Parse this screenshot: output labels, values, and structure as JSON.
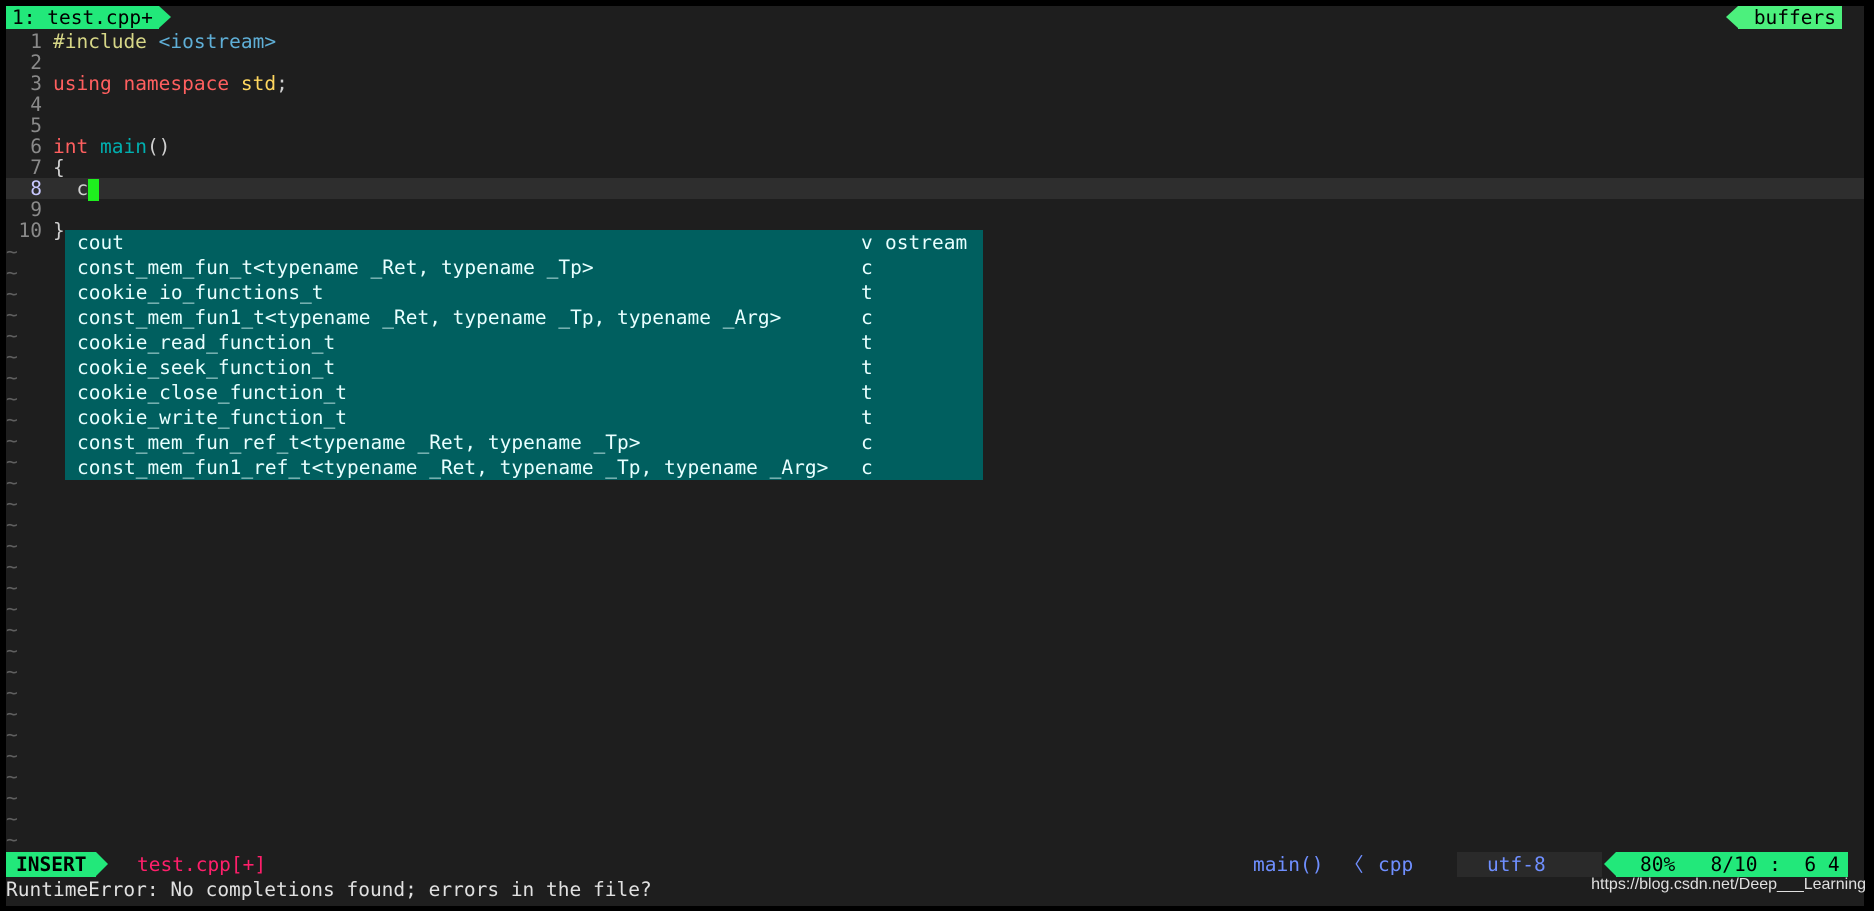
{
  "tabline": {
    "active_tab": "1: test.cpp+",
    "right_label": "buffers"
  },
  "code_lines": [
    {
      "num": "1",
      "tokens": [
        {
          "t": "#include ",
          "c": "pre"
        },
        {
          "t": "<iostream>",
          "c": "inc"
        }
      ]
    },
    {
      "num": "2",
      "tokens": []
    },
    {
      "num": "3",
      "tokens": [
        {
          "t": "using ",
          "c": "kw-red"
        },
        {
          "t": "namespace ",
          "c": "kw-red"
        },
        {
          "t": "std",
          "c": "std"
        },
        {
          "t": ";",
          "c": ""
        }
      ]
    },
    {
      "num": "4",
      "tokens": []
    },
    {
      "num": "5",
      "tokens": []
    },
    {
      "num": "6",
      "tokens": [
        {
          "t": "int ",
          "c": "kw-red"
        },
        {
          "t": "main",
          "c": "fn"
        },
        {
          "t": "()",
          "c": ""
        }
      ]
    },
    {
      "num": "7",
      "tokens": [
        {
          "t": "{",
          "c": ""
        }
      ]
    },
    {
      "num": "8",
      "tokens": [
        {
          "t": "  c",
          "c": ""
        }
      ]
    },
    {
      "num": "9",
      "tokens": []
    },
    {
      "num": "10",
      "tokens": [
        {
          "t": "}",
          "c": ""
        }
      ]
    }
  ],
  "tilde": "~",
  "completion": [
    {
      "word": "cout",
      "kind": "v",
      "menu": "ostream"
    },
    {
      "word": "const_mem_fun_t<typename _Ret, typename _Tp>",
      "kind": "c",
      "menu": ""
    },
    {
      "word": "cookie_io_functions_t",
      "kind": "t",
      "menu": ""
    },
    {
      "word": "const_mem_fun1_t<typename _Ret, typename _Tp, typename _Arg>",
      "kind": "c",
      "menu": ""
    },
    {
      "word": "cookie_read_function_t",
      "kind": "t",
      "menu": ""
    },
    {
      "word": "cookie_seek_function_t",
      "kind": "t",
      "menu": ""
    },
    {
      "word": "cookie_close_function_t",
      "kind": "t",
      "menu": ""
    },
    {
      "word": "cookie_write_function_t",
      "kind": "t",
      "menu": ""
    },
    {
      "word": "const_mem_fun_ref_t<typename _Ret, typename _Tp>",
      "kind": "c",
      "menu": ""
    },
    {
      "word": "const_mem_fun1_ref_t<typename _Ret, typename _Tp, typename _Arg>",
      "kind": "c",
      "menu": ""
    }
  ],
  "statusline": {
    "mode": "INSERT",
    "filename": "test.cpp[+]",
    "function": "main()",
    "separator": "〈",
    "filetype": "cpp",
    "encoding": "utf-8",
    "percent": "80%",
    "position": "8/10 :  6 4"
  },
  "message": "RuntimeError: No completions found; errors in the file?",
  "watermark": "https://blog.csdn.net/Deep___Learning"
}
